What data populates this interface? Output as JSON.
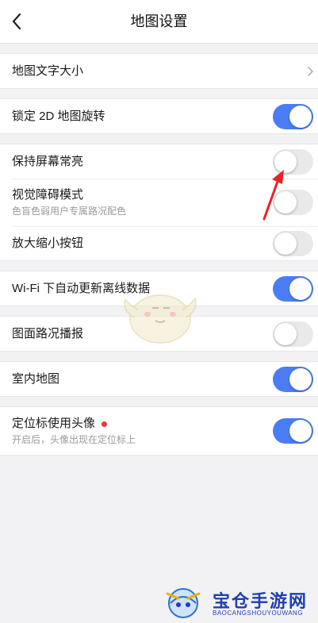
{
  "header": {
    "title": "地图设置"
  },
  "groups": [
    {
      "rows": [
        {
          "label": "地图文字大小",
          "control": "chevron"
        }
      ]
    },
    {
      "rows": [
        {
          "label": "锁定 2D 地图旋转",
          "control": "toggle",
          "on": true
        }
      ]
    },
    {
      "rows": [
        {
          "label": "保持屏幕常亮",
          "control": "toggle",
          "on": false
        },
        {
          "label": "视觉障碍模式",
          "sub": "色盲色弱用户专属路况配色",
          "control": "toggle",
          "on": false
        },
        {
          "label": "放大缩小按钮",
          "control": "toggle",
          "on": false
        }
      ]
    },
    {
      "rows": [
        {
          "label": "Wi-Fi 下自动更新离线数据",
          "control": "toggle",
          "on": true
        }
      ]
    },
    {
      "rows": [
        {
          "label": "图面路况播报",
          "control": "toggle",
          "on": false
        }
      ]
    },
    {
      "rows": [
        {
          "label": "室内地图",
          "control": "toggle",
          "on": true
        }
      ]
    },
    {
      "rows": [
        {
          "label": "定位标使用头像",
          "sub": "开启后，头像出现在定位标上",
          "control": "toggle",
          "on": true,
          "dot": true
        }
      ]
    }
  ],
  "watermark": {
    "text": "宝仓手游网",
    "sub": "BAOCANGSHOUYOUWANG"
  },
  "colors": {
    "toggle_on": "#4a7df5",
    "toggle_off": "#e9e9eb",
    "dot": "#e8363a",
    "annotation_arrow": "#e8232a"
  },
  "icons": {
    "back": "chevron-left-icon",
    "row_chevron": "chevron-right-icon"
  }
}
